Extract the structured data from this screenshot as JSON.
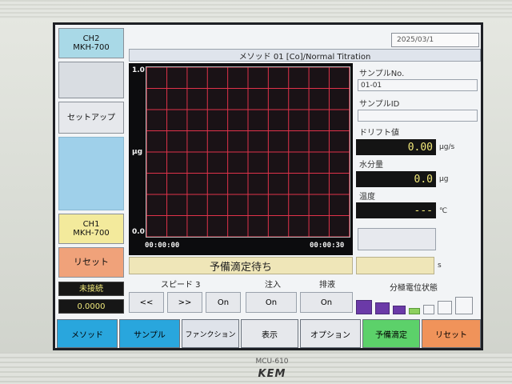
{
  "left_panel": {
    "ch2_line1": "CH2",
    "ch2_line2": "MKH-700",
    "setup": "セットアップ",
    "ch1_line1": "CH1",
    "ch1_line2": "MKH-700",
    "reset": "リセット",
    "connection": "未接続",
    "value": "0.0000"
  },
  "header": {
    "date": "2025/03/1",
    "method": "メソッド 01 [Co]/Normal Titration"
  },
  "chart_data": {
    "type": "line",
    "ylabel": "μg",
    "ylim": [
      0.0,
      1.0
    ],
    "y_tick_top": "1.0",
    "y_tick_bottom": "0.0",
    "x_start": "00:00:00",
    "x_end": "00:00:30",
    "grid": true,
    "series": []
  },
  "status_text": "予備滴定待ち",
  "right_panel": {
    "sample_no_label": "サンプルNo.",
    "sample_no_value": "01-01",
    "sample_id_label": "サンプルID",
    "sample_id_value": "",
    "drift_label": "ドリフト値",
    "drift_value": "0.00",
    "drift_unit": "μg/s",
    "water_label": "水分量",
    "water_value": "0.0",
    "water_unit": "μg",
    "temp_label": "温度",
    "temp_value": "---",
    "temp_unit": "℃",
    "time_unit": "s"
  },
  "controls": {
    "speed_label": "スピード 3",
    "rewind": "<<",
    "forward": ">>",
    "speed_on": "On",
    "inject_label": "注入",
    "inject_on": "On",
    "drain_label": "排液",
    "drain_on": "On",
    "electrode_label": "分極電位状態"
  },
  "tabs": {
    "method": "メソッド",
    "sample": "サンプル",
    "function": "ファンクション",
    "display": "表示",
    "option": "オプション",
    "pretitration": "予備滴定",
    "reset": "リセット"
  },
  "bezel": {
    "model": "MCU-610",
    "brand": "KEM"
  },
  "colors": {
    "tab_blue": "#29a6dd",
    "tab_green": "#5cd16a",
    "tab_orange": "#f0935a",
    "grid_red": "#e0324a"
  }
}
